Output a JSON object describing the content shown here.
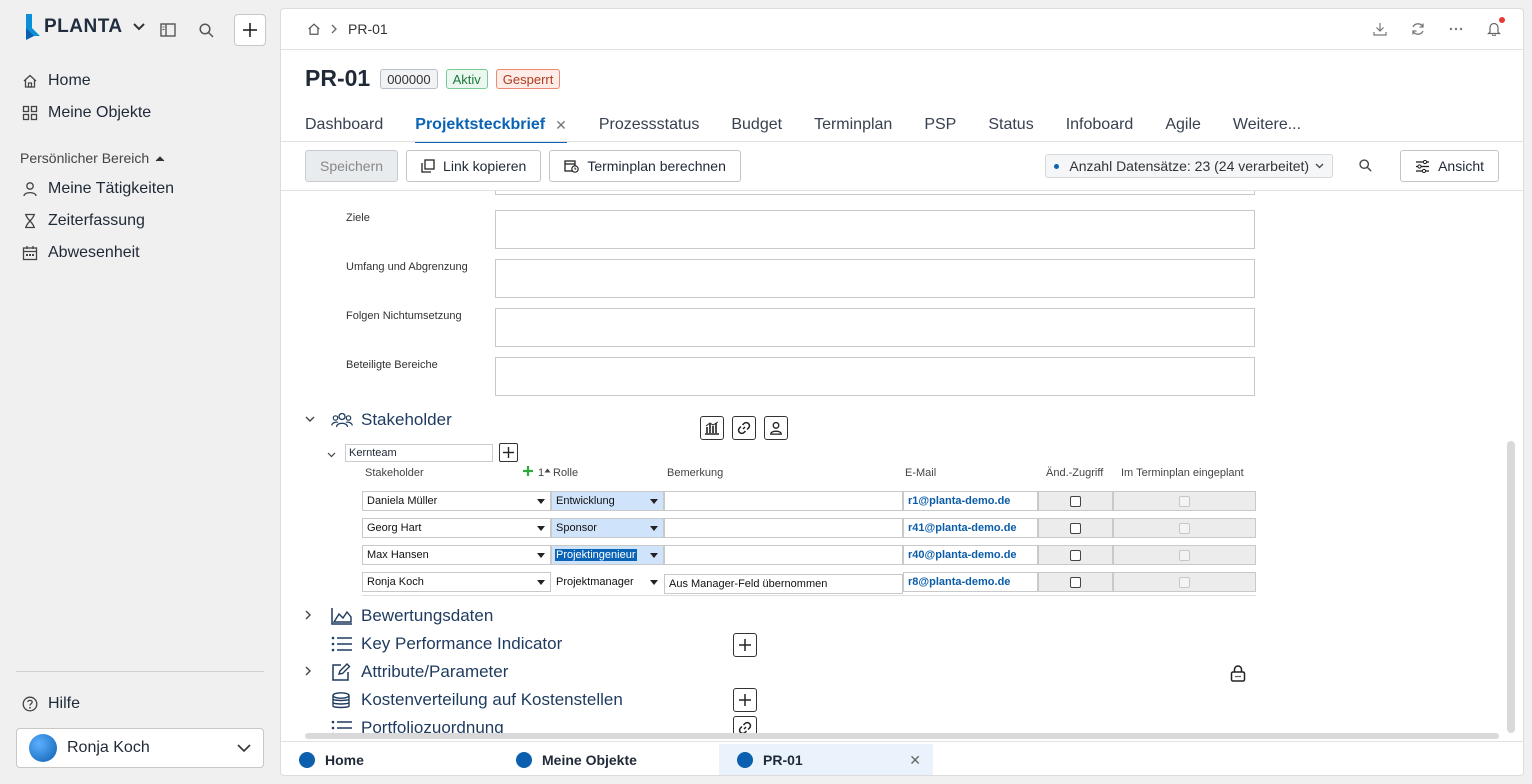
{
  "app": {
    "name": "PLANTA"
  },
  "sidebar": {
    "nav": [
      {
        "label": "Home",
        "icon": "home-icon"
      },
      {
        "label": "Meine Objekte",
        "icon": "grid-icon"
      }
    ],
    "section_label": "Persönlicher Bereich",
    "personal": [
      {
        "label": "Meine Tätigkeiten",
        "icon": "person-icon"
      },
      {
        "label": "Zeiterfassung",
        "icon": "hourglass-icon"
      },
      {
        "label": "Abwesenheit",
        "icon": "calendar-icon"
      }
    ],
    "help_label": "Hilfe",
    "user_name": "Ronja Koch"
  },
  "header": {
    "breadcrumb": "PR-01",
    "title": "PR-01",
    "badges": {
      "id": "000000",
      "status": "Aktiv",
      "lock": "Gesperrt"
    }
  },
  "tabs": [
    {
      "label": "Dashboard"
    },
    {
      "label": "Projektsteckbrief",
      "active": true
    },
    {
      "label": "Prozessstatus"
    },
    {
      "label": "Budget"
    },
    {
      "label": "Terminplan"
    },
    {
      "label": "PSP"
    },
    {
      "label": "Status"
    },
    {
      "label": "Infoboard"
    },
    {
      "label": "Agile"
    },
    {
      "label": "Weitere..."
    }
  ],
  "toolbar": {
    "save": "Speichern",
    "copy_link": "Link kopieren",
    "calc_schedule": "Terminplan berechnen",
    "records": "Anzahl Datensätze: 23 (24 verarbeitet)",
    "view": "Ansicht"
  },
  "fields": [
    {
      "label": "Ziele"
    },
    {
      "label": "Umfang und Abgrenzung"
    },
    {
      "label": "Folgen Nichtumsetzung"
    },
    {
      "label": "Beteiligte Bereiche"
    }
  ],
  "stakeholder": {
    "title": "Stakeholder",
    "group": "Kernteam",
    "sort_indicator": "1",
    "columns": {
      "stakeholder": "Stakeholder",
      "rolle": "Rolle",
      "bemerkung": "Bemerkung",
      "email": "E-Mail",
      "zugriff": "Änd.-Zugriff",
      "terminplan": "Im Terminplan eingeplant"
    },
    "rows": [
      {
        "name": "Daniela Müller",
        "role": "Entwicklung",
        "remark": "",
        "email": "r1@planta-demo.de"
      },
      {
        "name": "Georg Hart",
        "role": "Sponsor",
        "remark": "",
        "email": "r41@planta-demo.de"
      },
      {
        "name": "Max Hansen",
        "role": "Projektingenieur",
        "remark": "",
        "email": "r40@planta-demo.de"
      },
      {
        "name": "Ronja Koch",
        "role": "Projektmanager",
        "remark": "Aus Manager-Feld übernommen",
        "email": "r8@planta-demo.de"
      }
    ]
  },
  "sections": [
    {
      "title": "Bewertungsdaten"
    },
    {
      "title": "Key Performance Indicator"
    },
    {
      "title": "Attribute/Parameter"
    },
    {
      "title": "Kostenverteilung auf Kostenstellen"
    },
    {
      "title": "Portfoliozuordnung"
    }
  ],
  "bottom_tabs": [
    {
      "label": "Home"
    },
    {
      "label": "Meine Objekte"
    },
    {
      "label": "PR-01",
      "active": true
    }
  ],
  "colors": {
    "accent": "#0b63b6",
    "role_highlight": "#cfe3fa"
  }
}
